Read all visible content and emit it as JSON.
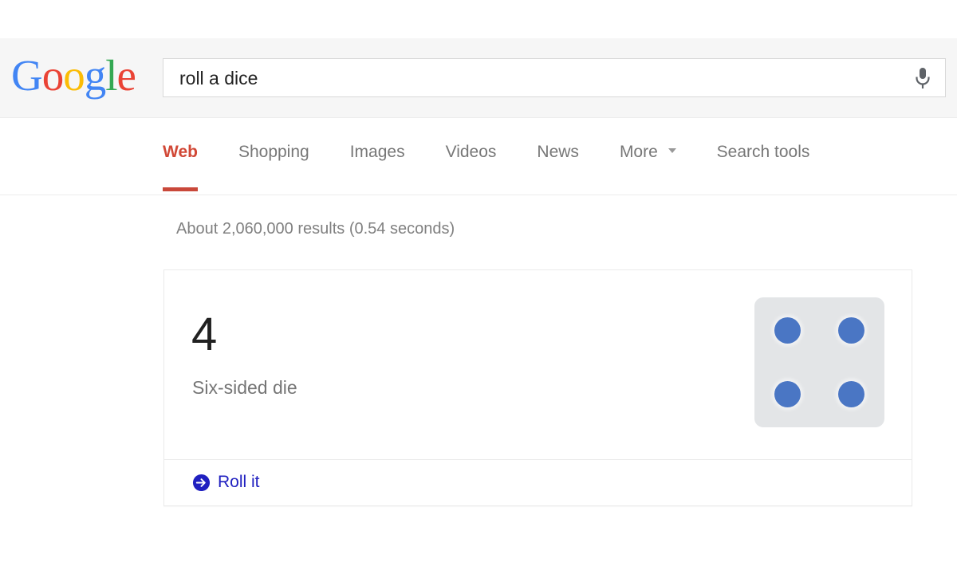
{
  "header": {
    "logo": {
      "name": "Google",
      "letters": [
        {
          "char": "G",
          "color": "#4285f4"
        },
        {
          "char": "o",
          "color": "#ea4335"
        },
        {
          "char": "o",
          "color": "#fbbc05"
        },
        {
          "char": "g",
          "color": "#4285f4"
        },
        {
          "char": "l",
          "color": "#34a853"
        },
        {
          "char": "e",
          "color": "#ea4335"
        }
      ]
    },
    "search": {
      "value": "roll a dice",
      "placeholder": "Search",
      "mic_icon": "microphone-icon"
    }
  },
  "nav": {
    "tabs": [
      {
        "label": "Web",
        "active": true
      },
      {
        "label": "Shopping",
        "active": false
      },
      {
        "label": "Images",
        "active": false
      },
      {
        "label": "Videos",
        "active": false
      },
      {
        "label": "News",
        "active": false
      },
      {
        "label": "More",
        "active": false,
        "caret": true
      },
      {
        "label": "Search tools",
        "active": false
      }
    ]
  },
  "results": {
    "stats": "About 2,060,000 results (0.54 seconds)"
  },
  "dice_card": {
    "value": "4",
    "label": "Six-sided die",
    "die": {
      "pip_count": 4,
      "pip_color": "#4a76c4",
      "face_color": "#e3e5e7"
    },
    "action": {
      "label": "Roll it",
      "icon": "arrow-circle-right-icon",
      "color": "#2020c0"
    }
  }
}
